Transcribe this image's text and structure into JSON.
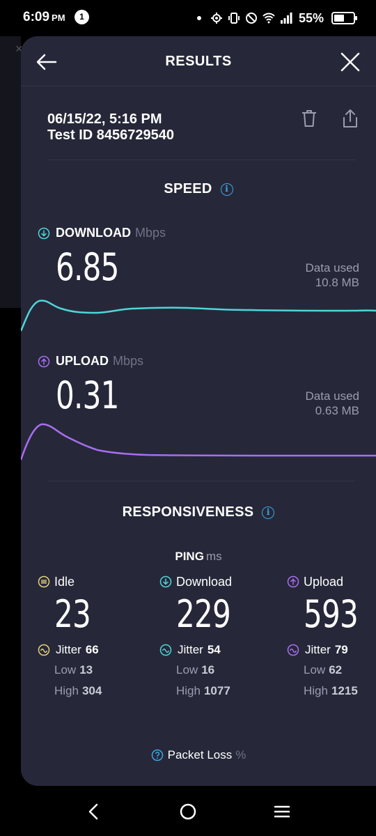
{
  "status_bar": {
    "time": "6:09",
    "ampm": "PM",
    "notification_count": "1",
    "battery_percent": "55%",
    "battery_level": 0.55
  },
  "header": {
    "title": "RESULTS",
    "back_icon": "arrow-left-icon",
    "close_icon": "close-icon"
  },
  "meta": {
    "datetime": "06/15/22, 5:16 PM",
    "test_id": "Test ID 8456729540"
  },
  "speed": {
    "title": "SPEED",
    "download": {
      "label": "DOWNLOAD",
      "unit": "Mbps",
      "value": "6.85",
      "data_used_label": "Data used",
      "data_used": "10.8 MB",
      "color": "#4fd6da"
    },
    "upload": {
      "label": "UPLOAD",
      "unit": "Mbps",
      "value": "0.31",
      "data_used_label": "Data used",
      "data_used": "0.63 MB",
      "color": "#a96ef0"
    }
  },
  "responsiveness": {
    "title": "RESPONSIVENESS",
    "ping_label": "PING",
    "ping_unit": "ms",
    "columns": [
      {
        "label": "Idle",
        "value": "23",
        "jitter_label": "Jitter",
        "jitter": "66",
        "low_label": "Low",
        "low": "13",
        "high_label": "High",
        "high": "304",
        "color": "#e6d27a"
      },
      {
        "label": "Download",
        "value": "229",
        "jitter_label": "Jitter",
        "jitter": "54",
        "low_label": "Low",
        "low": "16",
        "high_label": "High",
        "high": "1077",
        "color": "#4fd6da"
      },
      {
        "label": "Upload",
        "value": "593",
        "jitter_label": "Jitter",
        "jitter": "79",
        "low_label": "Low",
        "low": "62",
        "high_label": "High",
        "high": "1215",
        "color": "#a96ef0"
      }
    ],
    "packet_loss_label": "Packet Loss",
    "packet_loss_unit": "%"
  }
}
